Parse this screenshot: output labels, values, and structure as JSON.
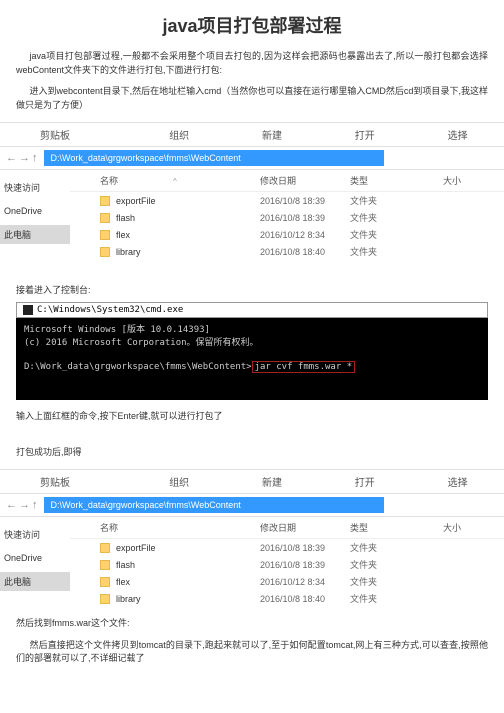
{
  "title": "java项目打包部署过程",
  "para1": "java项目打包部署过程,一般都不会采用整个项目去打包的,因为这样会把源码也暴露出去了,所以一般打包都会选择webContent文件夹下的文件进行打包,下面进行打包:",
  "para2": "进入到webcontent目录下,然后在地址栏输入cmd（当然你也可以直接在运行哪里输入CMD然后cd到项目录下,我这样做只是为了方便）",
  "toolbar": {
    "paste": "剪贴板",
    "org": "组织",
    "new": "新建",
    "open": "打开",
    "select": "选择"
  },
  "nav": {
    "back": "←",
    "fwd": "→",
    "up": "↑"
  },
  "path1": "D:\\Work_data\\grgworkspace\\fmms\\WebContent",
  "sidebar": {
    "quick": "快速访问",
    "onedrive": "OneDrive",
    "pc": "此电脑"
  },
  "cols": {
    "name": "名称",
    "date": "修改日期",
    "type": "类型",
    "size": "大小"
  },
  "files": [
    {
      "name": "exportFile",
      "date": "2016/10/8 18:39",
      "type": "文件夹"
    },
    {
      "name": "flash",
      "date": "2016/10/8 18:39",
      "type": "文件夹"
    },
    {
      "name": "flex",
      "date": "2016/10/12 8:34",
      "type": "文件夹"
    },
    {
      "name": "library",
      "date": "2016/10/8 18:40",
      "type": "文件夹"
    }
  ],
  "para3": "接着进入了控制台:",
  "cmd": {
    "title": "C:\\Windows\\System32\\cmd.exe",
    "line1": "Microsoft Windows [版本 10.0.14393]",
    "line2": "(c) 2016 Microsoft Corporation。保留所有权利。",
    "prompt": "D:\\Work_data\\grgworkspace\\fmms\\WebContent>",
    "command": "jar cvf fmms.war *"
  },
  "para4": "输入上面红框的命令,按下Enter键,就可以进行打包了",
  "para5": "打包成功后,即得",
  "path2": "D:\\Work_data\\grgworkspace\\fmms\\WebContent",
  "para6": "然后找到fmms.war这个文件:",
  "para7": "然后直接把这个文件拷贝到tomcat的目录下,跑起来就可以了,至于如何配置tomcat,网上有三种方式,可以查查,按照他们的部署就可以了,不详细记载了"
}
